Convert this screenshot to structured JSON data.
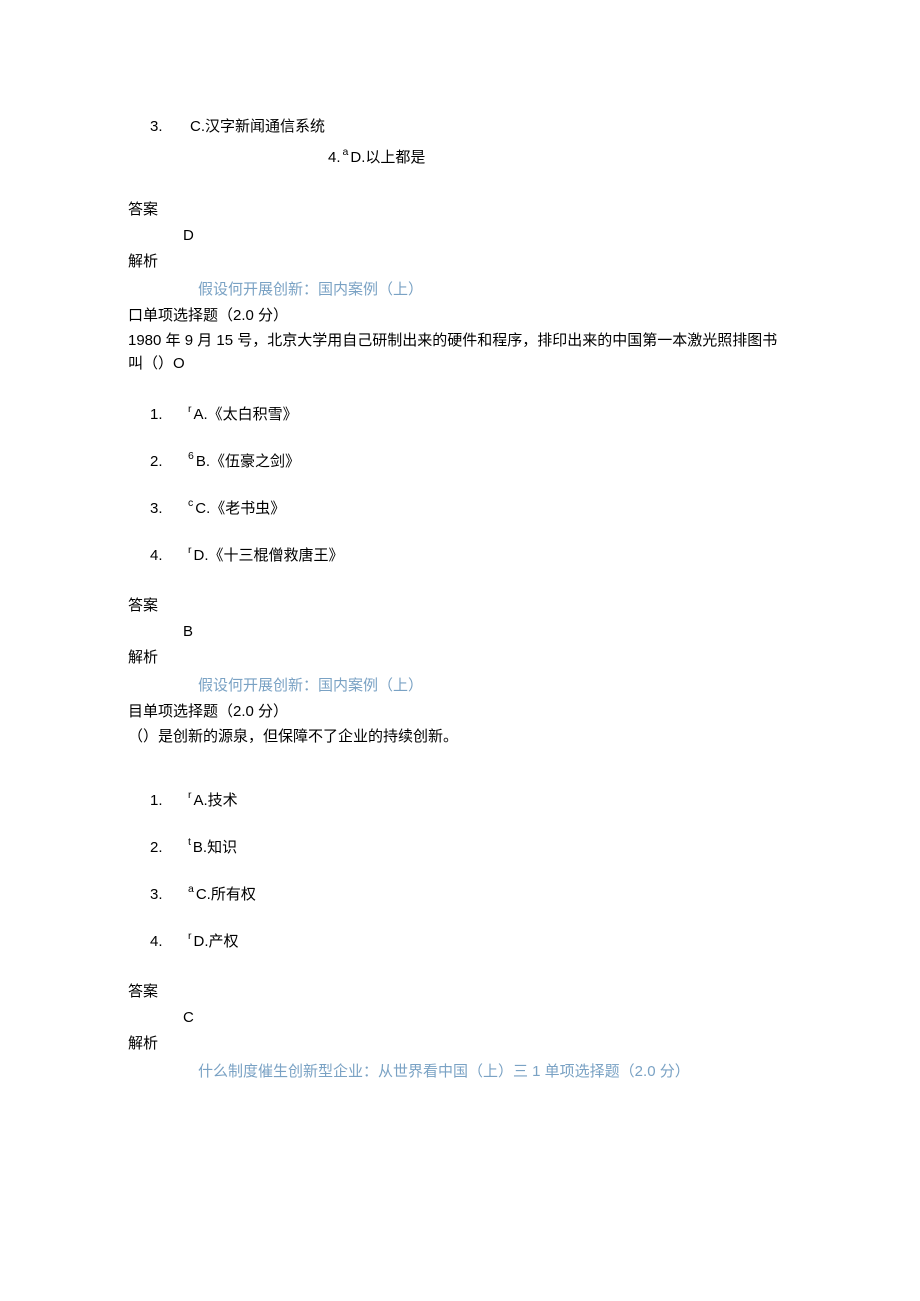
{
  "q0": {
    "opt3": {
      "n": "3.",
      "sup": "",
      "text": "C.汉字新闻通信系统"
    },
    "opt4_line": {
      "n": "4.",
      "sup": "a",
      "text": "D.以上都是"
    },
    "answer_label": "答案",
    "answer_value": "D",
    "analysis_label": "解析",
    "analysis_value": "假设何开展创新：国内案例（上）"
  },
  "q1": {
    "qtype": "口单项选择题（2.0 分）",
    "stem": "1980 年 9 月 15 号，北京大学用自己研制出来的硬件和程序，排印出来的中国第一本激光照排图书叫（）O",
    "opts": [
      {
        "n": "1.",
        "sup": "r",
        "text": "A.《太白积雪》"
      },
      {
        "n": "2.",
        "sup": "6",
        "text": "B.《伍豪之剑》"
      },
      {
        "n": "3.",
        "sup": "c",
        "text": "C.《老书虫》"
      },
      {
        "n": "4.",
        "sup": "r",
        "text": "D.《十三棍僧救唐王》"
      }
    ],
    "answer_label": "答案",
    "answer_value": "B",
    "analysis_label": "解析",
    "analysis_value": "假设何开展创新：国内案例（上）"
  },
  "q2": {
    "qtype": "目单项选择题（2.0 分）",
    "stem": "（）是创新的源泉，但保障不了企业的持续创新。",
    "opts": [
      {
        "n": "1.",
        "sup": "r",
        "text": "A.技术"
      },
      {
        "n": "2.",
        "sup": "t",
        "text": "B.知识"
      },
      {
        "n": "3.",
        "sup": "a",
        "text": "C.所有权"
      },
      {
        "n": "4.",
        "sup": "r",
        "text": "D.产权"
      }
    ],
    "answer_label": "答案",
    "answer_value": "C",
    "analysis_label": "解析",
    "analysis_value": "什么制度催生创新型企业：从世界看中国（上）三 1 单项选择题（2.0 分）"
  }
}
